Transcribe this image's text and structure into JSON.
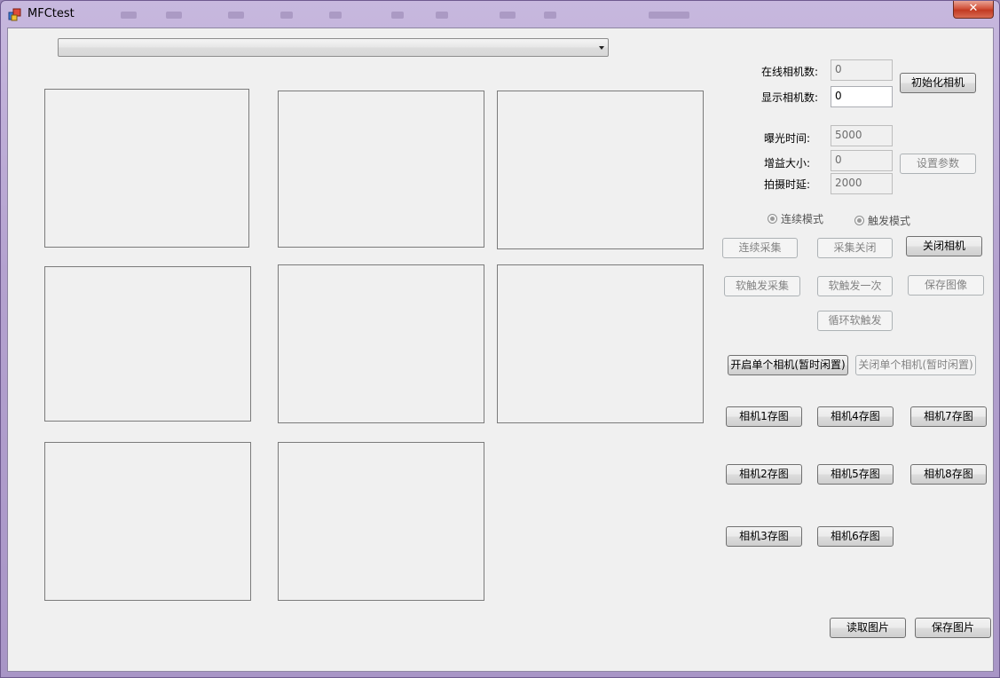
{
  "window": {
    "title": "MFCtest",
    "close_glyph": "✕"
  },
  "combo": {
    "value": ""
  },
  "labels": {
    "online_cameras": "在线相机数:",
    "display_cameras": "显示相机数:",
    "exposure": "曝光时间:",
    "gain": "增益大小:",
    "shoot_delay": "拍摄时延:"
  },
  "fields": {
    "online_cameras": "0",
    "display_cameras": "0",
    "exposure": "5000",
    "gain": "0",
    "shoot_delay": "2000"
  },
  "radios": {
    "continuous": "连续模式",
    "trigger": "触发模式"
  },
  "buttons": {
    "init_camera": "初始化相机",
    "set_params": "设置参数",
    "continuous_acquire": "连续采集",
    "acquire_close": "采集关闭",
    "close_camera": "关闭相机",
    "soft_trigger_acquire": "软触发采集",
    "soft_trigger_once": "软触发一次",
    "save_image": "保存图像",
    "loop_soft_trigger": "循环软触发",
    "open_single_camera": "开启单个相机(暂时闲置)",
    "close_single_camera": "关闭单个相机(暂时闲置)",
    "cam1_save": "相机1存图",
    "cam4_save": "相机4存图",
    "cam7_save": "相机7存图",
    "cam2_save": "相机2存图",
    "cam5_save": "相机5存图",
    "cam8_save": "相机8存图",
    "cam3_save": "相机3存图",
    "cam6_save": "相机6存图",
    "read_picture": "读取图片",
    "save_picture": "保存图片"
  },
  "colors": {
    "client_bg": "#f0f0f0",
    "title_gradient": "#b4a2cf",
    "close_red": "#c23a22"
  }
}
